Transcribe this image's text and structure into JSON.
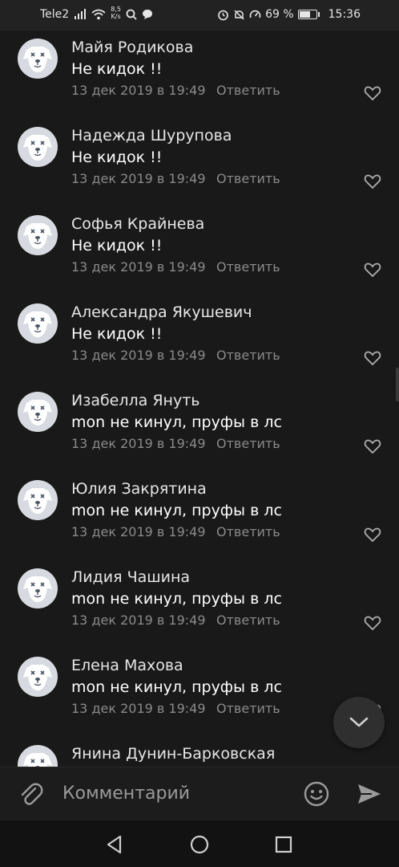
{
  "status_bar": {
    "carrier": "Tele2",
    "speed_value": "8,5",
    "speed_unit": "K/s",
    "battery": "69 %",
    "battery_level": 0.69,
    "time": "15:36"
  },
  "comments": [
    {
      "name": "Майя Родикова",
      "text": "Не кидок !!",
      "date": "13 дек 2019 в 19:49",
      "reply_label": "Ответить"
    },
    {
      "name": "Надежда Шурупова",
      "text": "Не кидок !!",
      "date": "13 дек 2019 в 19:49",
      "reply_label": "Ответить"
    },
    {
      "name": "Софья Крайнева",
      "text": "Не кидок !!",
      "date": "13 дек 2019 в 19:49",
      "reply_label": "Ответить"
    },
    {
      "name": "Александра Якушевич",
      "text": "Не кидок !!",
      "date": "13 дек 2019 в 19:49",
      "reply_label": "Ответить"
    },
    {
      "name": "Изабелла Януть",
      "text": "mon не кинул, пруфы в лс",
      "date": "13 дек 2019 в 19:49",
      "reply_label": "Ответить"
    },
    {
      "name": "Юлия Закрятина",
      "text": "mon не кинул, пруфы в лс",
      "date": "13 дек 2019 в 19:49",
      "reply_label": "Ответить"
    },
    {
      "name": "Лидия Чашина",
      "text": "mon не кинул, пруфы в лс",
      "date": "13 дек 2019 в 19:49",
      "reply_label": "Ответить"
    },
    {
      "name": "Елена Махова",
      "text": "mon не кинул, пруфы в лс",
      "date": "13 дек 2019 в 19:49",
      "reply_label": "Ответить"
    },
    {
      "name": "Янина Дунин-Барковская",
      "text": "",
      "date": "",
      "reply_label": ""
    }
  ],
  "composer": {
    "placeholder": "Комментарий"
  },
  "icons": {
    "avatar": "deactivated-dog-avatar",
    "like": "heart-outline-icon",
    "scroll_down": "chevron-down-icon",
    "attach": "paperclip-icon",
    "emoji": "smiley-icon",
    "send": "send-arrow-icon"
  },
  "colors": {
    "background": "#191919",
    "text_primary": "#e6e6e6",
    "text_secondary": "#8a8a8a",
    "avatar_bg": "#d7dbe1"
  }
}
